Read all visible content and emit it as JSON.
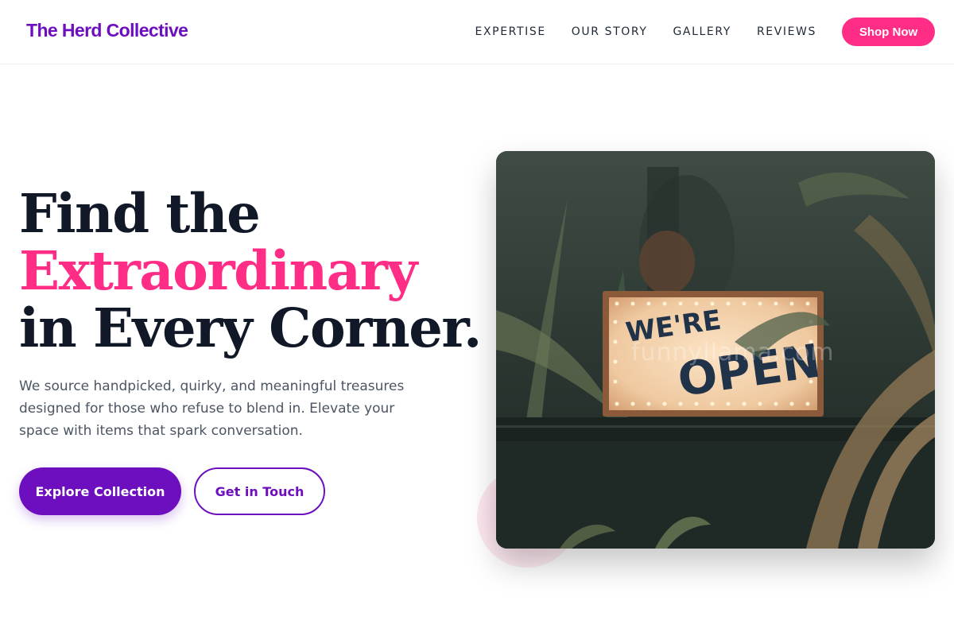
{
  "header": {
    "logo": "The Herd Collective",
    "nav": [
      "EXPERTISE",
      "OUR STORY",
      "GALLERY",
      "REVIEWS"
    ],
    "cta": "Shop Now"
  },
  "hero": {
    "headline": {
      "line1": "Find the",
      "line2": "Extraordinary",
      "line3": "in Every Corner."
    },
    "description": "We source handpicked, quirky, and meaningful treasures designed for those who refuse to blend in. Elevate your space with items that spark conversation.",
    "primary_button": "Explore Collection",
    "secondary_button": "Get in Touch",
    "image": {
      "sign_line1": "WE'RE",
      "sign_line2": "OPEN",
      "watermark": "funnyllama.com"
    }
  },
  "colors": {
    "brand_purple": "#6d0fbf",
    "accent_pink": "#ff2d86",
    "heading": "#111827",
    "body_text": "#4b5563"
  }
}
